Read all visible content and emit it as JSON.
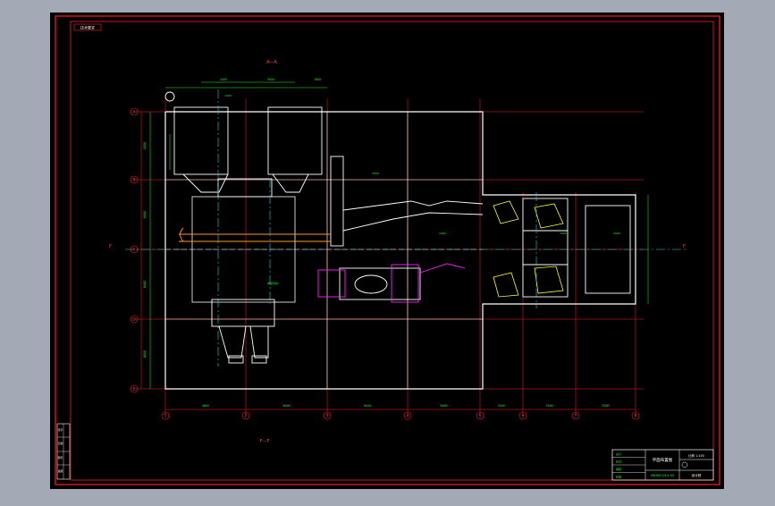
{
  "colors": {
    "background": "#a3aab6",
    "sheet": "#000000",
    "frame_red": "#ff2020",
    "equipment_white": "#ffffff",
    "centerline_cyan": "#21d3d3",
    "dimension_green": "#20ff20",
    "magenta": "#ff20ff",
    "yellow": "#ffff30",
    "orange": "#ff9a1e"
  },
  "drawing": {
    "corner_tag": "技术要求",
    "section_top": "A—A",
    "section_bottom": "F—F",
    "section_mark_left": "F",
    "section_mark_right": "F",
    "row_axes": [
      "A",
      "B",
      "C",
      "D",
      "E"
    ],
    "column_axes": [
      "1",
      "2",
      "3",
      "4",
      "5",
      "6",
      "7",
      "8"
    ],
    "dims_bottom": [
      "4800",
      "6000",
      "6000",
      "6000",
      "3200",
      "3200",
      "3200",
      "3500"
    ],
    "dims_top": [
      "3400",
      "3000",
      "1600"
    ],
    "dims_left": [
      "3000",
      "6000",
      "6000",
      "6000"
    ],
    "notes": [
      "1200",
      "3000",
      "焊接管线",
      "2400",
      "1500",
      "2000"
    ]
  },
  "title_block": {
    "drawing_title": "平面布置图",
    "drawing_number": "HB-WZ-03-1-00",
    "scale_note": "比例 1:100",
    "company": "设计院",
    "revision_rows": [
      "设计",
      "校对",
      "审核",
      "批准"
    ]
  },
  "side_stamp": [
    "签字",
    "日期",
    "图号",
    "底图"
  ]
}
